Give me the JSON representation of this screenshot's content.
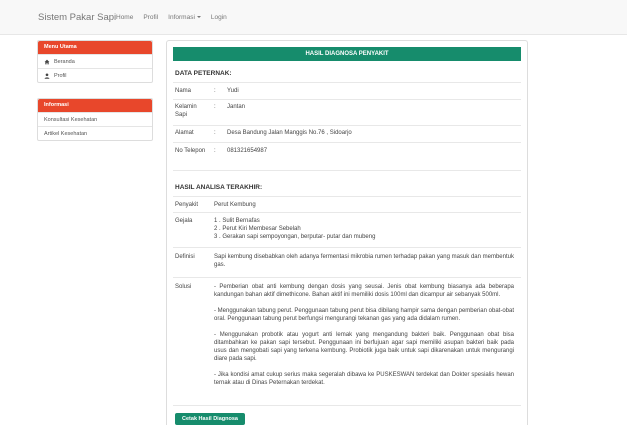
{
  "navbar": {
    "brand": "Sistem Pakar Sapi",
    "links": [
      "Home",
      "Profil",
      "Informasi",
      "Login"
    ]
  },
  "sidebar": {
    "menu_title": "Menu Utama",
    "menu_items": [
      {
        "label": "Beranda",
        "icon": "home-icon"
      },
      {
        "label": "Profil",
        "icon": "user-icon"
      }
    ],
    "info_title": "Informasi",
    "info_items": [
      "Konsultasi Kesehatan",
      "Artikel Kesehatan"
    ]
  },
  "main": {
    "header": "HASIL DIAGNOSA PENYAKIT",
    "data_title": "DATA PETERNAK:",
    "fields": [
      {
        "label": "Nama",
        "value": "Yudi"
      },
      {
        "label": "Kelamin Sapi",
        "value": "Jantan"
      },
      {
        "label": "Alamat",
        "value": "Desa Bandung Jalan Manggis No.76 , Sidoarjo"
      },
      {
        "label": "No Telepon",
        "value": "081321654987"
      }
    ],
    "analysis_title": "HASIL ANALISA TERAKHIR:",
    "penyakit": {
      "label": "Penyakit",
      "value": "Perut Kembung"
    },
    "gejala": {
      "label": "Gejala",
      "items": [
        "1 . Sulit Bernafas",
        "2 . Perut Kiri Membesar Sebelah",
        "3 . Gerakan sapi sempoyongan, berputar- putar dan mubeng"
      ]
    },
    "definisi": {
      "label": "Definisi",
      "text": "Sapi kembung disebabkan oleh adanya fermentasi mikrobia rumen terhadap pakan yang masuk dan membentuk gas."
    },
    "solusi": {
      "label": "Solusi",
      "paragraphs": [
        "- Pemberian obat anti kembung dengan dosis yang seusai. Jenis obat kembung biasanya ada beberapa kandungan bahan aktif dimethicone. Bahan aktif ini memiliki dosis 100ml dan dicampur air sebanyak 500ml.",
        "- Menggunakan tabung perut. Penggunaan tabung perut bisa dibilang hampir sama dengan pemberian obat-obat oral. Penggunaan tabung perut berfungsi mengurangi tekanan gas yang ada didalam rumen.",
        "- Menggunakan probotik atau yogurt anti lemak yang mengandung bakteri baik. Penggunaan obat bisa ditambahkan ke pakan sapi tersebut. Penggunaan ini berfujuan agar sapi memiliki asupan bakteri baik pada usus dan mengobati sapi yang terkena kembung. Probiotik juga baik untuk sapi dikarenakan untuk mengurangi diare pada sapi.",
        "- Jika kondisi amat cukup serius maka segeralah dibawa ke PUSKESWAN terdekat dan Dokter spesialis hewan ternak atau di Dinas Peternakan terdekat."
      ]
    },
    "print_button": "Cetak Hasil Diagnosa"
  },
  "colors": {
    "accent_red": "#e8472b",
    "accent_green": "#168c6c"
  }
}
